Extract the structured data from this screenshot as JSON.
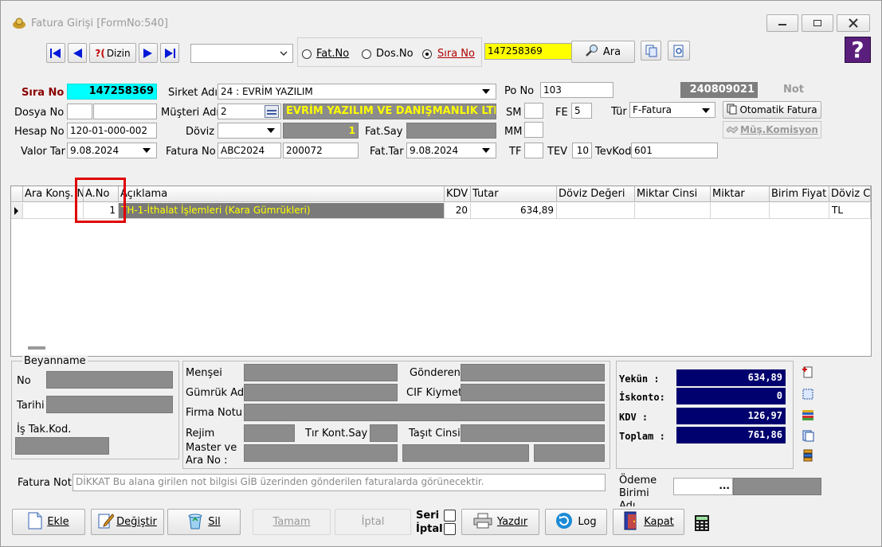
{
  "window": {
    "title": "Fatura Girişi [FormNo:540]"
  },
  "toolbar": {
    "dizin_label": "Dizin",
    "radio_fatno": "Fat.No",
    "radio_dosno": "Dos.No",
    "radio_sirano": "Sıra No",
    "search_value": "147258369",
    "ara_label": "Ara",
    "nav_help": "?("
  },
  "header": {
    "sira_no_label": "Sıra No",
    "sira_no_value": "147258369",
    "sirket_adi_label": "Sirket Adı",
    "sirket_adi_value": "24 : EVRİM YAZILIM",
    "po_no_label": "Po No",
    "po_no_value": "103",
    "code_value": "240809021",
    "not_label": "Not",
    "dosya_no_label": "Dosya No",
    "musteri_adi_label": "Müşteri Adı",
    "musteri_code": "2",
    "musteri_name": "EVRİM YAZILIM VE DANIŞMANLIK LTD",
    "sm_label": "SM",
    "fe_label": "FE",
    "fe_value": "5",
    "tur_label": "Tür",
    "tur_value": "F-Fatura",
    "otomatik_fatura": "Otomatik Fatura",
    "hesap_no_label": "Hesap No",
    "hesap_no_value": "120-01-000-002",
    "doviz_label": "Döviz",
    "doviz_rate": "1",
    "fat_say_label": "Fat.Say",
    "mm_label": "MM",
    "mus_komisyon": "Müş.Komisyon",
    "valor_tar_label": "Valor Tar",
    "valor_tar_value": "9.08.2024",
    "fatura_no_label": "Fatura No",
    "fatura_no_value1": "ABC2024",
    "fatura_no_value2": "200072",
    "fat_tar_label": "Fat.Tar",
    "fat_tar_value": "9.08.2024",
    "tf_label": "TF",
    "tev_label": "TEV",
    "tev_value": "10",
    "tevkod_label": "TevKod",
    "tevkod_value": "601"
  },
  "grid": {
    "columns": [
      "Ara Konş. No",
      "A.No",
      "Açıklama",
      "KDV",
      "Tutar",
      "Döviz Değeri",
      "Miktar Cinsi",
      "Miktar",
      "Birim Fiyat",
      "Döviz Ci"
    ],
    "rows": [
      {
        "ara_kons": "",
        "a_no": "1",
        "aciklama": "TH-1-İthalat İşlemleri  (Kara Gümrükleri)",
        "kdv": "20",
        "tutar": "634,89",
        "doviz_degeri": "",
        "miktar_cinsi": "",
        "miktar": "",
        "birim_fiyat": "",
        "doviz_cinsi": "TL"
      }
    ]
  },
  "beyanname": {
    "title": "Beyanname",
    "no_label": "No",
    "tarihi_label": "Tarihi",
    "is_tak_kod_label": "İş Tak.Kod."
  },
  "details": {
    "mensei": "Menşei",
    "gonderen": "Gönderen",
    "gumruk_adi": "Gümrük Adı",
    "cif_kiymet": "CIF Kiymet",
    "firma_notu": "Firma Notu",
    "rejim": "Rejim",
    "tir_kont_say": "Tır Kont.Say",
    "tasit_cinsi": "Taşıt Cinsi",
    "master_ve": "Master ve",
    "ara_no": "Ara No :"
  },
  "totals": {
    "yekun_label": "Yekün  :",
    "yekun_value": "634,89",
    "iskonto_label": "İskonto:",
    "iskonto_value": "0",
    "kdv_label": "KDV    :",
    "kdv_value": "126,97",
    "toplam_label": "Toplam :",
    "toplam_value": "761,86"
  },
  "fatura_not": {
    "label": "Fatura Not",
    "placeholder": "DİKKAT Bu alana girilen not bilgisi GİB üzerinden gönderilen faturalarda görünecektir."
  },
  "odeme": {
    "label_line1": "Ödeme",
    "label_line2": "Birimi",
    "label_line3": "Adı",
    "button": "..."
  },
  "buttons": {
    "ekle": "Ekle",
    "degistir": "Değiştir",
    "sil": "Sil",
    "tamam": "Tamam",
    "iptal": "İptal",
    "seri": "Seri",
    "iptal_check": "İptal",
    "yazdir": "Yazdır",
    "log": "Log",
    "kapat": "Kapat"
  },
  "colors": {
    "cyan": "#00ffff",
    "yellow_text": "#ffff00",
    "navy": "#00006e",
    "dark_red": "#8b0000",
    "gray": "#8c8c8c",
    "highlight_red": "#e00000"
  }
}
